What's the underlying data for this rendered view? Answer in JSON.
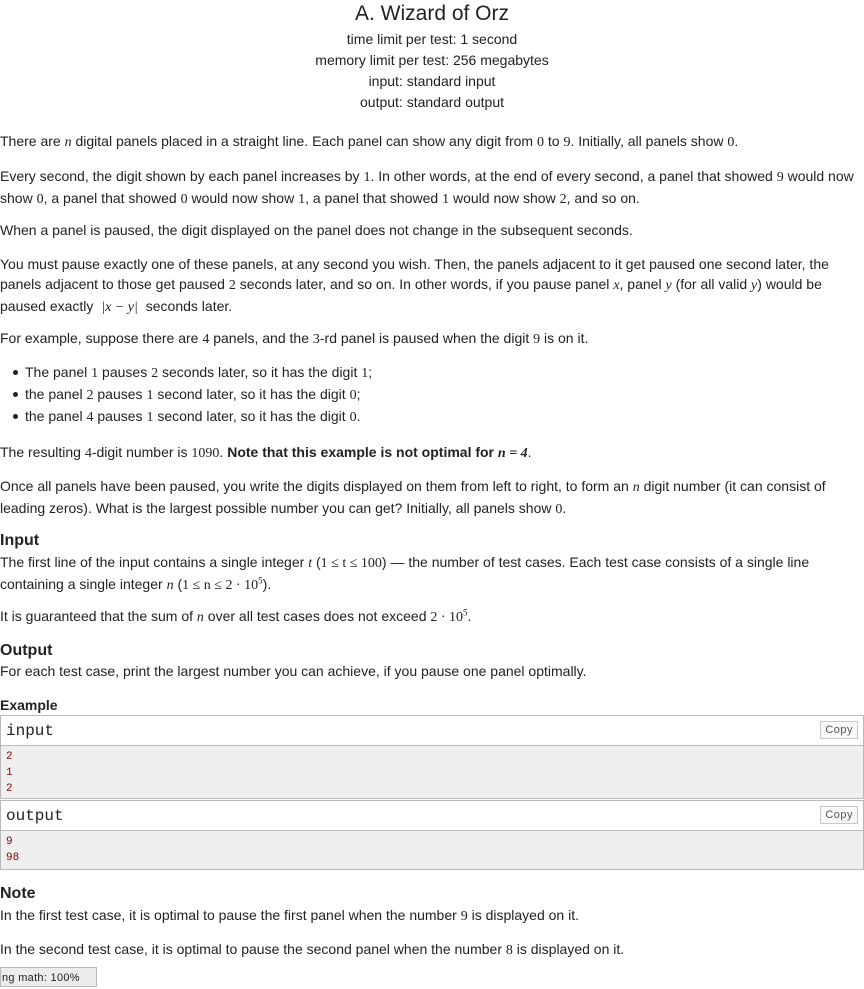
{
  "header": {
    "title": "A. Wizard of Orz",
    "time_limit": "time limit per test: 1 second",
    "memory_limit": "memory limit per test: 256 megabytes",
    "input": "input: standard input",
    "output": "output: standard output"
  },
  "statement": {
    "intro": [
      "There are ",
      "n",
      " digital panels placed in a straight line. Each panel can show any digit from ",
      "0",
      " to ",
      "9",
      ". Initially, all panels show ",
      "0",
      "."
    ],
    "every": [
      "Every second, the digit shown by each panel increases by ",
      "1",
      ". In other words, at the end of every second, a panel that showed ",
      "9",
      " would now show ",
      "0",
      ", a panel that showed ",
      "0",
      " would now show ",
      "1",
      ", a panel that showed ",
      "1",
      " would now show ",
      "2",
      ", and so on."
    ],
    "paused": "When a panel is paused, the digit displayed on the panel does not change in the subsequent seconds.",
    "must": [
      "You must pause exactly one of these panels, at any second you wish. Then, the panels adjacent to it get paused one second later, the panels adjacent to those get paused ",
      "2",
      " seconds later, and so on. In other words, if you pause panel ",
      "x",
      ", panel ",
      "y",
      " (for all valid ",
      "y",
      ") would be paused exactly ",
      "|x − y|",
      " seconds later."
    ],
    "example": [
      "For example, suppose there are ",
      "4",
      " panels, and the ",
      "3",
      "-rd panel is paused when the digit ",
      "9",
      " is on it."
    ],
    "bullets": [
      [
        "The panel ",
        "1",
        " pauses ",
        "2",
        " seconds later, so it has the digit ",
        "1",
        ";"
      ],
      [
        "the panel ",
        "2",
        " pauses ",
        "1",
        " second later, so it has the digit ",
        "0",
        ";"
      ],
      [
        "the panel ",
        "4",
        " pauses ",
        "1",
        " second later, so it has the digit ",
        "0",
        "."
      ]
    ],
    "result": [
      "The resulting ",
      "4",
      "-digit number is ",
      "1090",
      ". ",
      "Note that this example is not optimal for ",
      "n = 4",
      "."
    ],
    "once": [
      "Once all panels have been paused, you write the digits displayed on them from left to right, to form an ",
      "n",
      " digit number (it can consist of leading zeros). What is the largest possible number you can get? Initially, all panels show ",
      "0",
      "."
    ]
  },
  "input_section": {
    "title": "Input",
    "text": [
      "The first line of the input contains a single integer ",
      "t",
      " (",
      "1 ≤ t ≤ 100",
      ") — the number of test cases. Each test case consists of a single line containing a single integer ",
      "n",
      " (",
      "1 ≤ n ≤ 2 · 10",
      "5",
      ")."
    ],
    "sum": [
      "It is guaranteed that the sum of ",
      "n",
      " over all test cases does not exceed ",
      "2 · 10",
      "5",
      "."
    ]
  },
  "output_section": {
    "title": "Output",
    "text": "For each test case, print the largest number you can achieve, if you pause one panel optimally."
  },
  "example_section": {
    "title": "Example",
    "input_label": "input",
    "output_label": "output",
    "copy_label": "Copy",
    "input_lines": [
      "2",
      "1",
      "2"
    ],
    "output_lines": [
      "9",
      "98"
    ]
  },
  "note_section": {
    "title": "Note",
    "note1": [
      "In the first test case, it is optimal to pause the first panel when the number ",
      "9",
      " is displayed on it."
    ],
    "note2": [
      "In the second test case, it is optimal to pause the second panel when the number ",
      "8",
      " is displayed on it."
    ]
  },
  "status_bar": {
    "text": "ng math: 100%"
  }
}
